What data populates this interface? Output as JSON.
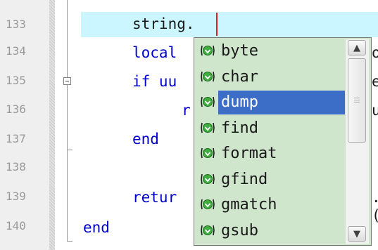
{
  "editor": {
    "lines": [
      {
        "number": "133",
        "code": "string."
      },
      {
        "number": "134",
        "code": "local"
      },
      {
        "number": "135",
        "code": "if uu"
      },
      {
        "number": "136",
        "code": "r"
      },
      {
        "number": "137",
        "code": "end"
      },
      {
        "number": "138",
        "code": ""
      },
      {
        "number": "139",
        "code": "retur"
      },
      {
        "number": "140",
        "code": "end"
      }
    ],
    "right_fragments": {
      "line134": "or",
      "line135": "e",
      "line136": "u",
      "line139": ".("
    }
  },
  "autocomplete": {
    "items": [
      {
        "label": "byte",
        "icon": "green-method-icon"
      },
      {
        "label": "char",
        "icon": "green-method-icon"
      },
      {
        "label": "dump",
        "icon": "green-method-icon",
        "selected": true
      },
      {
        "label": "find",
        "icon": "green-method-icon"
      },
      {
        "label": "format",
        "icon": "green-method-icon"
      },
      {
        "label": "gfind",
        "icon": "green-method-icon"
      },
      {
        "label": "gmatch",
        "icon": "green-method-icon"
      },
      {
        "label": "gsub",
        "icon": "green-method-icon"
      }
    ],
    "scroll_up_glyph": "▲",
    "scroll_down_glyph": "▼",
    "colors": {
      "popup_bg": "#cfe6cc",
      "selection": "#3d6ec7",
      "current_line": "#ccf6ff"
    }
  }
}
